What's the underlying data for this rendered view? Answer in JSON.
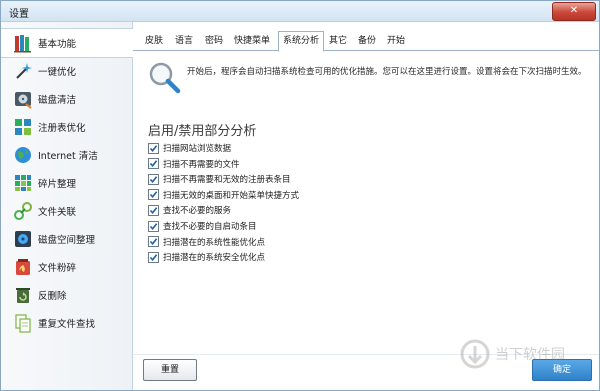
{
  "window": {
    "title": "设置",
    "close_label": "✕"
  },
  "sidebar": {
    "items": [
      {
        "label": "基本功能",
        "icon": "books-icon",
        "active": true
      },
      {
        "label": "一键优化",
        "icon": "magic-wand-icon"
      },
      {
        "label": "磁盘清洁",
        "icon": "disk-clean-icon"
      },
      {
        "label": "注册表优化",
        "icon": "registry-icon"
      },
      {
        "label": "Internet 清洁",
        "icon": "globe-icon"
      },
      {
        "label": "碎片整理",
        "icon": "defrag-icon"
      },
      {
        "label": "文件关联",
        "icon": "link-icon"
      },
      {
        "label": "磁盘空间整理",
        "icon": "disk-space-icon"
      },
      {
        "label": "文件粉碎",
        "icon": "shredder-icon"
      },
      {
        "label": "反删除",
        "icon": "undelete-icon"
      },
      {
        "label": "重复文件查找",
        "icon": "duplicate-files-icon"
      }
    ]
  },
  "tabs": [
    {
      "label": "皮肤"
    },
    {
      "label": "语言"
    },
    {
      "label": "密码"
    },
    {
      "label": "快捷菜单"
    },
    {
      "label": "系统分析",
      "active": true
    },
    {
      "label": "其它"
    },
    {
      "label": "备份"
    },
    {
      "label": "开始"
    }
  ],
  "panel": {
    "description": "开始后，程序会自动扫描系统检查可用的优化措施。您可以在这里进行设置。设置将会在下次扫描时生效。",
    "section_title": "启用/禁用部分分析",
    "options": [
      {
        "label": "扫描网站浏览数据",
        "checked": true
      },
      {
        "label": "扫描不再需要的文件",
        "checked": true
      },
      {
        "label": "扫描不再需要和无效的注册表条目",
        "checked": true
      },
      {
        "label": "扫描无效的桌面和开始菜单快捷方式",
        "checked": true
      },
      {
        "label": "查找不必要的服务",
        "checked": true
      },
      {
        "label": "查找不必要的自启动条目",
        "checked": true
      },
      {
        "label": "扫描潜在的系统性能优化点",
        "checked": true
      },
      {
        "label": "扫描潜在的系统安全优化点",
        "checked": true
      }
    ]
  },
  "buttons": {
    "reset": "重置",
    "ok": "确定"
  },
  "watermark": {
    "text": "当下软件园"
  },
  "colors": {
    "accent": "#2f82c9",
    "check": "#1f5fa8",
    "title_bar": "#d2e4f2"
  }
}
